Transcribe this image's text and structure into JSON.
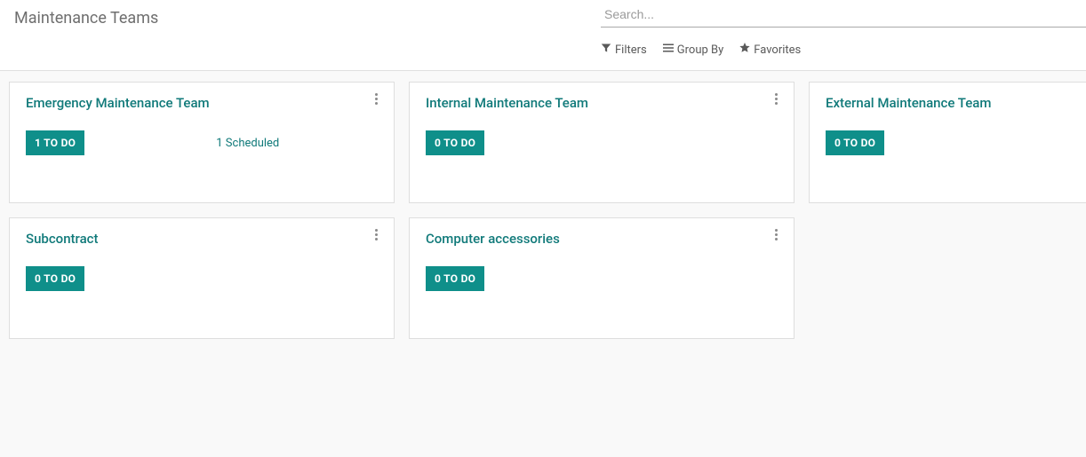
{
  "page_title": "Maintenance Teams",
  "search": {
    "placeholder": "Search..."
  },
  "toolbar": {
    "filters": "Filters",
    "groupby": "Group By",
    "favorites": "Favorites"
  },
  "cards": [
    {
      "title": "Emergency Maintenance Team",
      "todo": "1 TO DO",
      "scheduled": "1 Scheduled"
    },
    {
      "title": "Internal Maintenance Team",
      "todo": "0 TO DO"
    },
    {
      "title": "External Maintenance Team",
      "todo": "0 TO DO"
    },
    {
      "title": "Subcontract",
      "todo": "0 TO DO"
    },
    {
      "title": "Computer accessories",
      "todo": "0 TO DO"
    }
  ]
}
